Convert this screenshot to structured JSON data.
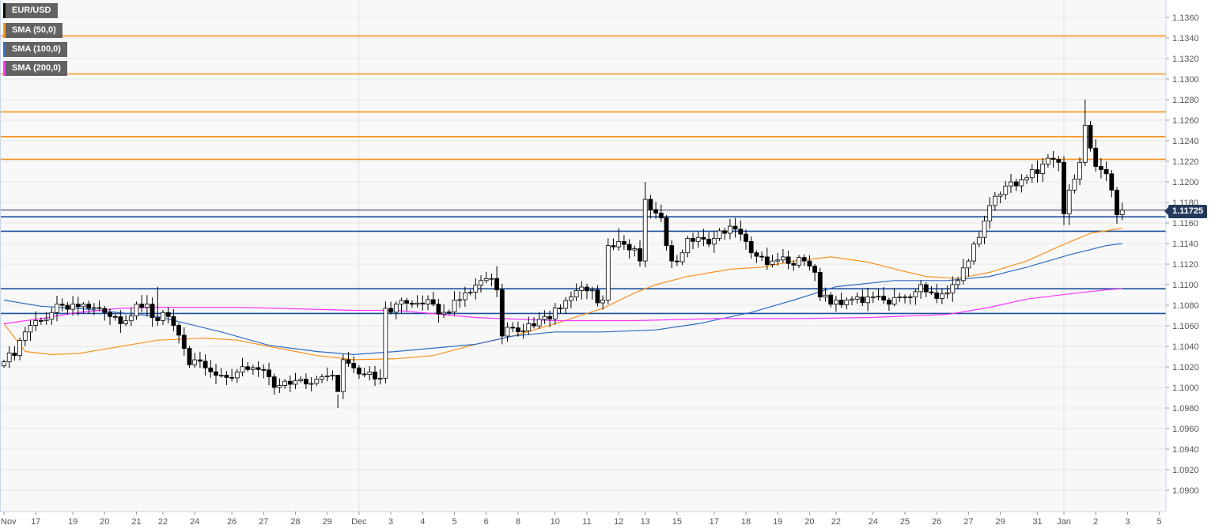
{
  "chart_data": {
    "type": "candlestick",
    "symbol": "EUR/USD",
    "legend": [
      {
        "label": "EUR/USD",
        "color": "#000000"
      },
      {
        "label": "SMA (50,0)",
        "color": "#f7931e"
      },
      {
        "label": "SMA (100,0)",
        "color": "#2f6bc2"
      },
      {
        "label": "SMA (200,0)",
        "color": "#ff33ff"
      }
    ],
    "last_price": "1.11725",
    "ylim": [
      1.0886,
      1.1377
    ],
    "y_ticks": [
      "1.1360",
      "1.1340",
      "1.1320",
      "1.1300",
      "1.1280",
      "1.1260",
      "1.1240",
      "1.1220",
      "1.1200",
      "1.1180",
      "1.1160",
      "1.1140",
      "1.1120",
      "1.1100",
      "1.1080",
      "1.1060",
      "1.1040",
      "1.1020",
      "1.1000",
      "1.0980",
      "1.0960",
      "1.0940",
      "1.0920",
      "1.0900"
    ],
    "x_ticks": [
      {
        "label": "Nov",
        "bar": 0
      },
      {
        "label": "17",
        "bar": 6
      },
      {
        "label": "19",
        "bar": 13
      },
      {
        "label": "20",
        "bar": 19
      },
      {
        "label": "21",
        "bar": 25
      },
      {
        "label": "22",
        "bar": 30
      },
      {
        "label": "24",
        "bar": 36
      },
      {
        "label": "26",
        "bar": 43
      },
      {
        "label": "27",
        "bar": 49
      },
      {
        "label": "28",
        "bar": 55
      },
      {
        "label": "29",
        "bar": 61
      },
      {
        "label": "Dec",
        "bar": 67
      },
      {
        "label": "3",
        "bar": 73
      },
      {
        "label": "4",
        "bar": 79
      },
      {
        "label": "5",
        "bar": 85
      },
      {
        "label": "6",
        "bar": 91
      },
      {
        "label": "8",
        "bar": 97
      },
      {
        "label": "10",
        "bar": 104
      },
      {
        "label": "11",
        "bar": 110
      },
      {
        "label": "12",
        "bar": 116
      },
      {
        "label": "13",
        "bar": 121
      },
      {
        "label": "15",
        "bar": 127
      },
      {
        "label": "17",
        "bar": 134
      },
      {
        "label": "18",
        "bar": 140
      },
      {
        "label": "19",
        "bar": 146
      },
      {
        "label": "20",
        "bar": 152
      },
      {
        "label": "22",
        "bar": 157
      },
      {
        "label": "24",
        "bar": 164
      },
      {
        "label": "25",
        "bar": 170
      },
      {
        "label": "26",
        "bar": 176
      },
      {
        "label": "27",
        "bar": 182
      },
      {
        "label": "29",
        "bar": 188
      },
      {
        "label": "31",
        "bar": 195
      },
      {
        "label": "Jan",
        "bar": 200
      },
      {
        "label": "2",
        "bar": 206
      },
      {
        "label": "3",
        "bar": 212
      },
      {
        "label": "5",
        "bar": 218
      }
    ],
    "month_separators": [
      67,
      200
    ],
    "bar_count": 212,
    "close_path": [
      [
        0,
        1.1025
      ],
      [
        2,
        1.1031
      ],
      [
        4,
        1.1054
      ],
      [
        7,
        1.1065
      ],
      [
        10,
        1.1081
      ],
      [
        13,
        1.1081
      ],
      [
        16,
        1.1077
      ],
      [
        20,
        1.1069
      ],
      [
        22,
        1.1062
      ],
      [
        25,
        1.1081
      ],
      [
        27,
        1.1081
      ],
      [
        29,
        1.1065
      ],
      [
        31,
        1.1069
      ],
      [
        34,
        1.1038
      ],
      [
        35,
        1.1022
      ],
      [
        38,
        1.1019
      ],
      [
        41,
        1.1012
      ],
      [
        44,
        1.1015
      ],
      [
        49,
        1.1017
      ],
      [
        51,
        1.1
      ],
      [
        53,
        1.1006
      ],
      [
        56,
        1.1008
      ],
      [
        59,
        1.1008
      ],
      [
        62,
        1.1012
      ],
      [
        63,
        1.0996
      ],
      [
        64,
        1.1027
      ],
      [
        66,
        1.1019
      ],
      [
        69,
        1.1015
      ],
      [
        71,
        1.1009
      ],
      [
        72,
        1.1077
      ],
      [
        74,
        1.1081
      ],
      [
        77,
        1.1081
      ],
      [
        81,
        1.1081
      ],
      [
        83,
        1.1073
      ],
      [
        85,
        1.1085
      ],
      [
        87,
        1.1092
      ],
      [
        90,
        1.1104
      ],
      [
        92,
        1.1106
      ],
      [
        93,
        1.1095
      ],
      [
        94,
        1.105
      ],
      [
        96,
        1.1058
      ],
      [
        99,
        1.1062
      ],
      [
        102,
        1.1069
      ],
      [
        105,
        1.1077
      ],
      [
        107,
        1.1088
      ],
      [
        110,
        1.1094
      ],
      [
        113,
        1.1085
      ],
      [
        114,
        1.1138
      ],
      [
        116,
        1.1142
      ],
      [
        119,
        1.1135
      ],
      [
        120,
        1.1123
      ],
      [
        121,
        1.1183
      ],
      [
        122,
        1.1173
      ],
      [
        124,
        1.1165
      ],
      [
        125,
        1.1138
      ],
      [
        126,
        1.1123
      ],
      [
        128,
        1.1131
      ],
      [
        129,
        1.1145
      ],
      [
        131,
        1.1146
      ],
      [
        134,
        1.1145
      ],
      [
        136,
        1.115
      ],
      [
        138,
        1.1154
      ],
      [
        140,
        1.1142
      ],
      [
        141,
        1.1131
      ],
      [
        143,
        1.1127
      ],
      [
        145,
        1.1123
      ],
      [
        147,
        1.1127
      ],
      [
        149,
        1.1119
      ],
      [
        151,
        1.1123
      ],
      [
        153,
        1.1112
      ],
      [
        154,
        1.1088
      ],
      [
        156,
        1.1081
      ],
      [
        157,
        1.1085
      ],
      [
        159,
        1.1085
      ],
      [
        161,
        1.1088
      ],
      [
        163,
        1.1088
      ],
      [
        166,
        1.1085
      ],
      [
        167,
        1.1081
      ],
      [
        169,
        1.1088
      ],
      [
        171,
        1.1088
      ],
      [
        173,
        1.11
      ],
      [
        175,
        1.1092
      ],
      [
        177,
        1.1091
      ],
      [
        178,
        1.1092
      ],
      [
        180,
        1.1104
      ],
      [
        182,
        1.1123
      ],
      [
        184,
        1.1146
      ],
      [
        186,
        1.1177
      ],
      [
        187,
        1.1186
      ],
      [
        189,
        1.1196
      ],
      [
        190,
        1.12
      ],
      [
        192,
        1.1202
      ],
      [
        193,
        1.1204
      ],
      [
        195,
        1.1208
      ],
      [
        197,
        1.1223
      ],
      [
        199,
        1.1219
      ],
      [
        200,
        1.1169
      ],
      [
        201,
        1.1192
      ],
      [
        203,
        1.1219
      ],
      [
        204,
        1.1255
      ],
      [
        206,
        1.1215
      ],
      [
        207,
        1.1212
      ],
      [
        209,
        1.1192
      ],
      [
        210,
        1.1168
      ],
      [
        211,
        1.11725
      ]
    ],
    "high_overrides": [
      [
        121,
        1.12
      ],
      [
        204,
        1.128
      ],
      [
        63,
        1.098
      ],
      [
        93,
        1.1118
      ],
      [
        29,
        1.1098
      ],
      [
        116,
        1.1155
      ]
    ],
    "low_overrides": [
      [
        72,
        1.1004
      ],
      [
        94,
        1.1042
      ],
      [
        200,
        1.1158
      ],
      [
        201,
        1.1158
      ]
    ],
    "sma": [
      {
        "name": "SMA (50,0)",
        "color": "#f7931e",
        "points": [
          [
            0,
            1.1062
          ],
          [
            4,
            1.1035
          ],
          [
            9,
            1.1032
          ],
          [
            14,
            1.1033
          ],
          [
            29,
            1.1046
          ],
          [
            38,
            1.1048
          ],
          [
            44,
            1.1046
          ],
          [
            52,
            1.1038
          ],
          [
            59,
            1.1031
          ],
          [
            66,
            1.1027
          ],
          [
            74,
            1.1028
          ],
          [
            81,
            1.1031
          ],
          [
            89,
            1.1042
          ],
          [
            96,
            1.105
          ],
          [
            104,
            1.1062
          ],
          [
            113,
            1.1077
          ],
          [
            119,
            1.1092
          ],
          [
            123,
            1.11
          ],
          [
            129,
            1.1108
          ],
          [
            137,
            1.1115
          ],
          [
            143,
            1.1117
          ],
          [
            149,
            1.1123
          ],
          [
            156,
            1.1127
          ],
          [
            163,
            1.1122
          ],
          [
            169,
            1.1114
          ],
          [
            174,
            1.1108
          ],
          [
            180,
            1.1106
          ],
          [
            186,
            1.1112
          ],
          [
            193,
            1.1123
          ],
          [
            199,
            1.1137
          ],
          [
            205,
            1.115
          ],
          [
            211,
            1.1155
          ]
        ]
      },
      {
        "name": "SMA (100,0)",
        "color": "#2f6bc2",
        "points": [
          [
            0,
            1.1085
          ],
          [
            7,
            1.1079
          ],
          [
            14,
            1.1077
          ],
          [
            29,
            1.1069
          ],
          [
            41,
            1.1054
          ],
          [
            50,
            1.1041
          ],
          [
            59,
            1.1035
          ],
          [
            66,
            1.1032
          ],
          [
            74,
            1.1035
          ],
          [
            89,
            1.1042
          ],
          [
            96,
            1.105
          ],
          [
            104,
            1.1054
          ],
          [
            113,
            1.1054
          ],
          [
            123,
            1.1056
          ],
          [
            131,
            1.1062
          ],
          [
            141,
            1.1073
          ],
          [
            149,
            1.1085
          ],
          [
            157,
            1.1098
          ],
          [
            168,
            1.1104
          ],
          [
            178,
            1.1104
          ],
          [
            186,
            1.1108
          ],
          [
            193,
            1.1117
          ],
          [
            201,
            1.1129
          ],
          [
            208,
            1.1138
          ],
          [
            211,
            1.114
          ]
        ]
      },
      {
        "name": "SMA (200,0)",
        "color": "#ff33ff",
        "points": [
          [
            0,
            1.1062
          ],
          [
            7,
            1.1067
          ],
          [
            14,
            1.1073
          ],
          [
            22,
            1.1077
          ],
          [
            29,
            1.1078
          ],
          [
            44,
            1.1078
          ],
          [
            66,
            1.1075
          ],
          [
            74,
            1.1075
          ],
          [
            89,
            1.1068
          ],
          [
            104,
            1.1065
          ],
          [
            119,
            1.1065
          ],
          [
            134,
            1.1067
          ],
          [
            149,
            1.1067
          ],
          [
            163,
            1.1068
          ],
          [
            178,
            1.1071
          ],
          [
            186,
            1.1078
          ],
          [
            193,
            1.1086
          ],
          [
            201,
            1.1091
          ],
          [
            208,
            1.1095
          ],
          [
            211,
            1.1096
          ]
        ]
      }
    ],
    "resistance_levels": {
      "color": "#f7931e",
      "values": [
        1.1342,
        1.1305,
        1.1268,
        1.1244,
        1.1222
      ]
    },
    "support_levels": {
      "color": "#1c4f9c",
      "values": [
        1.1166,
        1.1152,
        1.1096,
        1.1072
      ]
    },
    "last_price_value": 1.11725,
    "grid": true
  }
}
